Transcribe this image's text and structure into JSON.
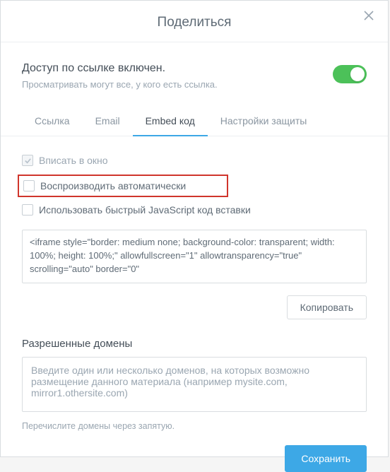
{
  "dialog": {
    "title": "Поделиться"
  },
  "access": {
    "title": "Доступ по ссылке включен.",
    "desc": "Просматривать могут все, у кого есть ссылка."
  },
  "tabs": {
    "link": "Ссылка",
    "email": "Email",
    "embed": "Embed код",
    "security": "Настройки защиты"
  },
  "checks": {
    "fit": "Вписать в окно",
    "autoplay": "Воспроизводить автоматически",
    "fastjs": "Использовать быстрый JavaScript код вставки"
  },
  "code": "<iframe style=\"border: medium none; background-color: transparent; width: 100%; height: 100%;\" allowfullscreen=\"1\" allowtransparency=\"true\" scrolling=\"auto\" border=\"0\"",
  "copy_label": "Копировать",
  "domains": {
    "title": "Разрешенные домены",
    "placeholder": "Введите один или несколько доменов, на которых возможно размещение данного материала (например mysite.com, mirror1.othersite.com)",
    "hint": "Перечислите домены через запятую."
  },
  "save_label": "Сохранить"
}
